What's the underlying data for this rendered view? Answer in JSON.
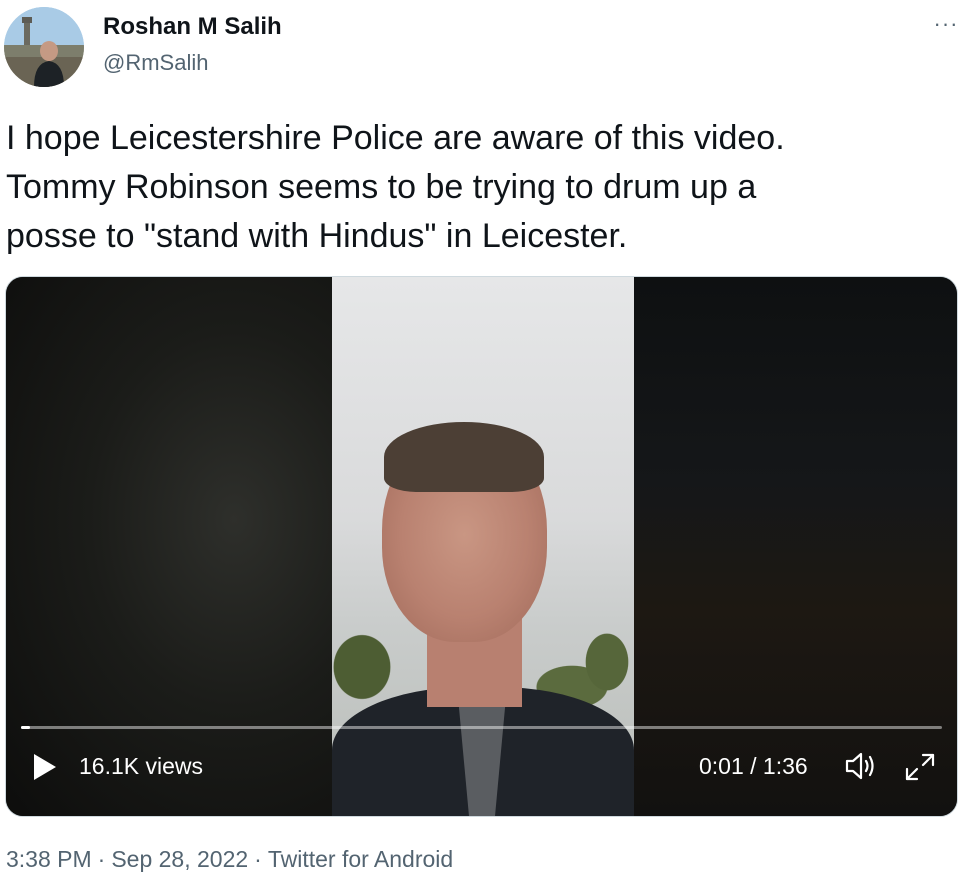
{
  "author": {
    "name": "Roshan M Salih",
    "handle": "@RmSalih"
  },
  "more_label": "···",
  "tweet_text": {
    "lines": [
      "I hope Leicestershire Police are aware of this video.",
      "Tommy Robinson seems to be trying to drum up a",
      "posse to \"stand with Hindus\" in Leicester."
    ]
  },
  "video": {
    "views": "16.1K views",
    "time": "0:01 / 1:36",
    "progress_fraction": 0.01,
    "icons": {
      "play": "play-icon",
      "volume": "volume-icon",
      "fullscreen": "fullscreen-icon"
    }
  },
  "meta": {
    "time": "3:38 PM",
    "date": "Sep 28, 2022",
    "source": "Twitter for Android",
    "separator": "·"
  },
  "colors": {
    "text": "#0f1419",
    "secondary": "#536471"
  }
}
